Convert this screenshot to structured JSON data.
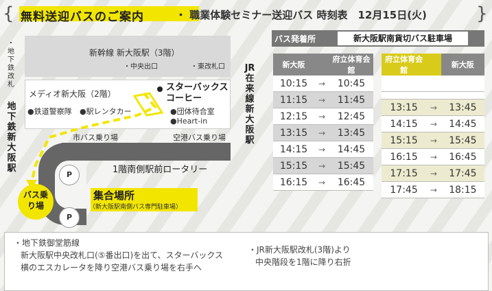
{
  "header": {
    "title": "無料送迎バスのご案内",
    "subtitle": "・ 職業体験セミナー送迎バス 時刻表　12月15日(火)"
  },
  "map": {
    "subway_gate": "・地下鉄改札",
    "subway_station": "地下鉄 新大阪駅",
    "shinkansen": "新幹線 新大阪駅（3階）",
    "central_exit": "・中央出口",
    "east_exit": "・東改札口",
    "media": "メディオ新大阪（2階）",
    "starbucks": "スターバックスコーヒー",
    "police": "●鉄道警察隊",
    "rental": "●駅レンタカー",
    "group_room": "●団体待合室",
    "heartin": "●Heart-in",
    "city_bus": "市バス乗り場",
    "airport_bus": "空港バス乗り場",
    "rotary": "1階南側駅前ロータリー",
    "jr_line": "JR在来線 新大阪駅",
    "bus_stop": "バス乗り場",
    "meeting_point": "集合場所",
    "meeting_point_sub": "（新大阪駅南側バス専門駐車場）",
    "parking": "P"
  },
  "timetable": {
    "stop_label": "バス発着所",
    "stop_name": "新大阪駅南貨切バス駐車場",
    "arrow": "→",
    "left": {
      "from": "新大阪",
      "to": "府立体育会館",
      "rows": [
        {
          "dep": "10:15",
          "arr": "10:45"
        },
        {
          "dep": "11:15",
          "arr": "11:45"
        },
        {
          "dep": "12:15",
          "arr": "12:45"
        },
        {
          "dep": "13:15",
          "arr": "13:45"
        },
        {
          "dep": "14:15",
          "arr": "14:45"
        },
        {
          "dep": "15:15",
          "arr": "15:45"
        },
        {
          "dep": "16:15",
          "arr": "16:45"
        }
      ]
    },
    "right": {
      "from": "府立体育会館",
      "to": "新大阪",
      "rows": [
        {
          "dep": "",
          "arr": ""
        },
        {
          "dep": "",
          "arr": ""
        },
        {
          "dep": "13:15",
          "arr": "13:45"
        },
        {
          "dep": "14:15",
          "arr": "14:45"
        },
        {
          "dep": "15:15",
          "arr": "15:45"
        },
        {
          "dep": "16:15",
          "arr": "16:45"
        },
        {
          "dep": "17:15",
          "arr": "17:45"
        },
        {
          "dep": "17:45",
          "arr": "18:15"
        }
      ]
    }
  },
  "footer": {
    "subway_line1": "・地下鉄御堂筋線",
    "subway_line2": "新大阪駅中央改札口(⑤番出口)を出て、スターバックス",
    "subway_line3": "横のエスカレータを降り空港バス乗り場を右手へ",
    "jr_line1": "・JR新大阪駅改札(3階)より",
    "jr_line2": "中央階段を1階に降り右折"
  },
  "colors": {
    "accent_yellow": "#f2e600",
    "road_gray": "#666666",
    "building_gray": "#d9d9d9"
  }
}
